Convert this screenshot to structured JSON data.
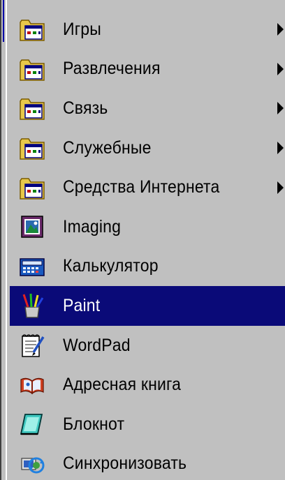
{
  "menu": {
    "items": [
      {
        "label": "Игры",
        "icon": "program-group-folder-icon",
        "submenu": true
      },
      {
        "label": "Развлечения",
        "icon": "program-group-folder-icon",
        "submenu": true
      },
      {
        "label": "Связь",
        "icon": "program-group-folder-icon",
        "submenu": true
      },
      {
        "label": "Служебные",
        "icon": "program-group-folder-icon",
        "submenu": true
      },
      {
        "label": "Средства Интернета",
        "icon": "program-group-folder-icon",
        "submenu": true
      },
      {
        "label": "Imaging",
        "icon": "imaging-icon",
        "submenu": false
      },
      {
        "label": "Калькулятор",
        "icon": "calculator-icon",
        "submenu": false
      },
      {
        "label": "Paint",
        "icon": "paint-icon",
        "submenu": false,
        "highlighted": true
      },
      {
        "label": "WordPad",
        "icon": "wordpad-icon",
        "submenu": false
      },
      {
        "label": "Адресная книга",
        "icon": "address-book-icon",
        "submenu": false
      },
      {
        "label": "Блокнот",
        "icon": "notepad-icon",
        "submenu": false
      },
      {
        "label": "Синхронизовать",
        "icon": "synchronize-icon",
        "submenu": false
      }
    ]
  },
  "colors": {
    "menu_background": "#c0c0c0",
    "highlight": "#0a0a78",
    "highlight_text": "#ffffff",
    "text": "#000000"
  }
}
